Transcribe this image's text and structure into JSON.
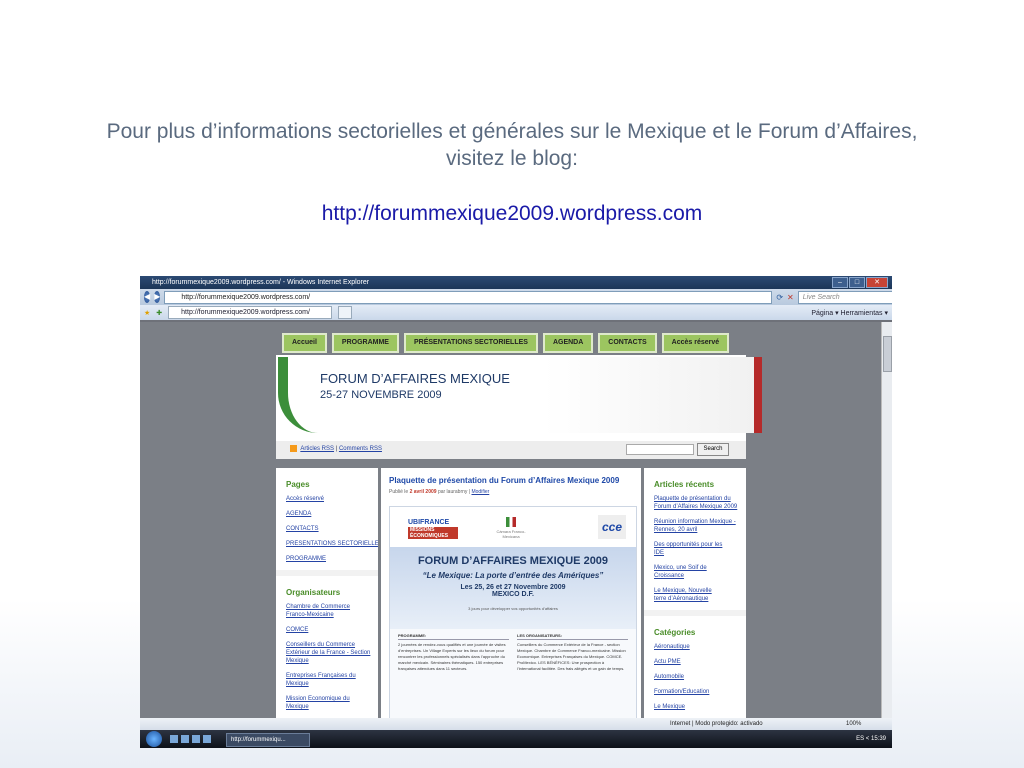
{
  "slide": {
    "title": "Pour plus d’informations sectorielles et générales sur le Mexique et le Forum d’Affaires, visitez le blog:",
    "link": "http://forummexique2009.wordpress.com"
  },
  "browser": {
    "window_title": "http://forummexique2009.wordpress.com/ - Windows Internet Explorer",
    "address": "http://forummexique2009.wordpress.com/",
    "search_placeholder": "Live Search",
    "tab_label": "http://forummexique2009.wordpress.com/",
    "tools": "Página ▾  Herramientas ▾",
    "status_zone": "Internet | Modo protegido: activado",
    "zoom": "100%"
  },
  "site": {
    "nav": [
      "Accueil",
      "PROGRAMME",
      "PRÉSENTATIONS SECTORIELLES",
      "AGENDA",
      "CONTACTS",
      "Accès réservé"
    ],
    "banner_title": "FORUM D’AFFAIRES MEXIQUE",
    "banner_dates": "25-27 NOVEMBRE 2009",
    "rss_articles": "Articles RSS",
    "rss_comments": "Comments RSS",
    "search_button": "Search",
    "pages_heading": "Pages",
    "pages": [
      "Accès réservé",
      "AGENDA",
      "CONTACTS",
      "PRÉSENTATIONS SECTORIELLES",
      "PROGRAMME"
    ],
    "org_heading": "Organisateurs",
    "orgs": [
      "Chambre de Commerce Franco-Mexicaine",
      "COMCE",
      "Conseillers du Commerce Extérieur de la France - Section Mexique",
      "Entreprises Françaises du Mexique",
      "Mission Economique du Mexique"
    ],
    "post_title": "Plaquette de présentation du Forum d’Affaires Mexique 2009",
    "post_meta_prefix": "Publié le",
    "post_date": "2 avril 2009",
    "post_author": "par laurabrny |",
    "post_edit": "Modifier",
    "recent_heading": "Articles récents",
    "recent": [
      "Plaquette de présentation du Forum d’Affaires Mexique 2009",
      "Réunion information Mexique - Rennes, 20 avril",
      "Des opportunités pour les IDE",
      "Mexico, une Soif de Croissance",
      "Le Mexique, Nouvelle terre d’Aéronautique"
    ],
    "cat_heading": "Catégories",
    "cats": [
      "Aéronautique",
      "Actu PME",
      "Automobile",
      "Formation/Education",
      "Le Mexique"
    ]
  },
  "brochure": {
    "ubi": "UBIFRANCE",
    "ubi_sub": "MISSIONS ÉCONOMIQUES",
    "cam": "Cámara Franco-Mexicana",
    "cce": "cce",
    "t1": "FORUM D’AFFAIRES MEXIQUE 2009",
    "t2": "“Le Mexique: La porte d’entrée des Amériques”",
    "t3": "Les 25, 26 et 27 Novembre 2009",
    "t4": "MEXICO D.F.",
    "t5": "3 jours pour développer vos opportunités d’affaires",
    "col1_head": "PROGRAMME:",
    "col1_text": "2 journées de rendez-vous qualifiés et une journée de visites d’entreprises. Un Village Experts sur les lieux du forum pour rencontrer les professionnels spécialisés dans l’approche du marché mexicain. Séminaires thématiques. 150 entreprises françaises attendues dans 11 secteurs.",
    "col2_head": "LES ORGANISATEURS:",
    "col2_text": "Conseillers du Commerce Extérieur de la France - section Mexique. Chambre de Commerce Franco-mexicaine. Mission Economique. Entreprises Françaises du Mexique. COMCE. ProMexico. LES BÉNÉFICES: Une prospection à l’international facilitée. Des frais allégés et un gain de temps."
  },
  "taskbar": {
    "task": "http://forummexiqu...",
    "tray": "ES  <  15:39"
  }
}
